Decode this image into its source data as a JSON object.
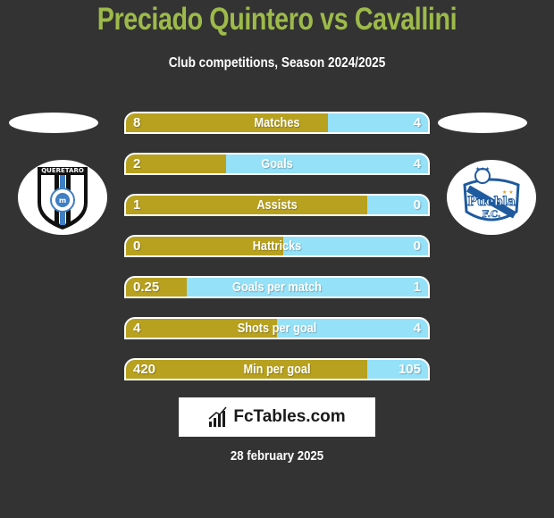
{
  "header": {
    "title": "Preciado Quintero vs Cavallini",
    "subtitle": "Club competitions, Season 2024/2025"
  },
  "teams": {
    "left": {
      "name": "Queretaro",
      "logo_icon": "queretaro-crest-icon",
      "crest_text": "QUERETARO"
    },
    "right": {
      "name": "Puebla F.C.",
      "logo_icon": "puebla-crest-icon",
      "crest_text": "Puebla F.C."
    }
  },
  "colors": {
    "left_bar": "#b8a11e",
    "right_bar": "#94e1f8",
    "title": "#9dba4a",
    "background": "#333333"
  },
  "stats": [
    {
      "label": "Matches",
      "left": "8",
      "right": "4",
      "left_share": 0.67
    },
    {
      "label": "Goals",
      "left": "2",
      "right": "4",
      "left_share": 0.33
    },
    {
      "label": "Assists",
      "left": "1",
      "right": "0",
      "left_share": 0.8
    },
    {
      "label": "Hattricks",
      "left": "0",
      "right": "0",
      "left_share": 0.52
    },
    {
      "label": "Goals per match",
      "left": "0.25",
      "right": "1",
      "left_share": 0.2
    },
    {
      "label": "Shots per goal",
      "left": "4",
      "right": "4",
      "left_share": 0.5
    },
    {
      "label": "Min per goal",
      "left": "420",
      "right": "105",
      "left_share": 0.8
    }
  ],
  "brand": {
    "name": "FcTables.com",
    "icon": "bar-chart-icon"
  },
  "footer": {
    "date": "28 february 2025"
  }
}
